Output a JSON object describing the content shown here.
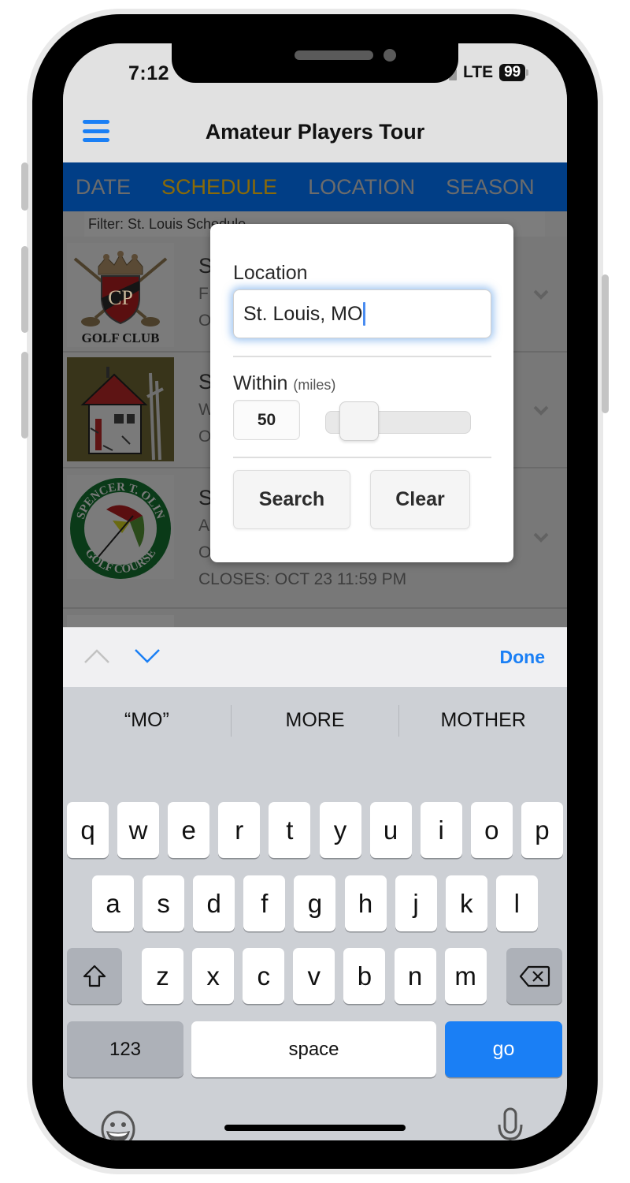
{
  "status_bar": {
    "time": "7:12",
    "network": "LTE",
    "battery": "99"
  },
  "header": {
    "title": "Amateur Players Tour",
    "menu_icon": "hamburger-menu-icon"
  },
  "tabs": [
    {
      "label": "DATE",
      "active": false
    },
    {
      "label": "SCHEDULE",
      "active": true
    },
    {
      "label": "LOCATION",
      "active": false
    },
    {
      "label": "SEASON",
      "active": false
    }
  ],
  "filter": {
    "text": "Filter: St. Louis Schedule"
  },
  "list": {
    "items": [
      {
        "logo": "cp-golf-club-logo",
        "logo_text": "GOLF CLUB",
        "title": "S",
        "line1": "F",
        "line2": "O"
      },
      {
        "logo": "stone-house-logo",
        "title": "S",
        "line1": "W",
        "line2": "O"
      },
      {
        "logo": "spencer-t-olin-golf-course-logo",
        "logo_text_top": "SPENCER T. OLIN",
        "logo_text_bottom": "GOLF COURSE",
        "title": "S",
        "line1": "A",
        "line2": "O",
        "line3": "CLOSES: OCT 23 11:59 PM"
      }
    ]
  },
  "modal": {
    "location_label": "Location",
    "location_value": "St. Louis, MO",
    "within_label": "Within",
    "within_unit": "(miles)",
    "miles_value": "50",
    "slider_fraction": 0.13,
    "search_label": "Search",
    "clear_label": "Clear"
  },
  "keyboard_accessory": {
    "done_label": "Done"
  },
  "keyboard": {
    "suggestions": [
      "“MO”",
      "MORE",
      "MOTHER"
    ],
    "row1": [
      "q",
      "w",
      "e",
      "r",
      "t",
      "y",
      "u",
      "i",
      "o",
      "p"
    ],
    "row2": [
      "a",
      "s",
      "d",
      "f",
      "g",
      "h",
      "j",
      "k",
      "l"
    ],
    "row3": [
      "z",
      "x",
      "c",
      "v",
      "b",
      "n",
      "m"
    ],
    "numbers_label": "123",
    "space_label": "space",
    "go_label": "go"
  },
  "colors": {
    "accent_blue": "#1a7ff5",
    "tab_bar_blue": "#013e86",
    "active_tab": "#8a6a08"
  }
}
